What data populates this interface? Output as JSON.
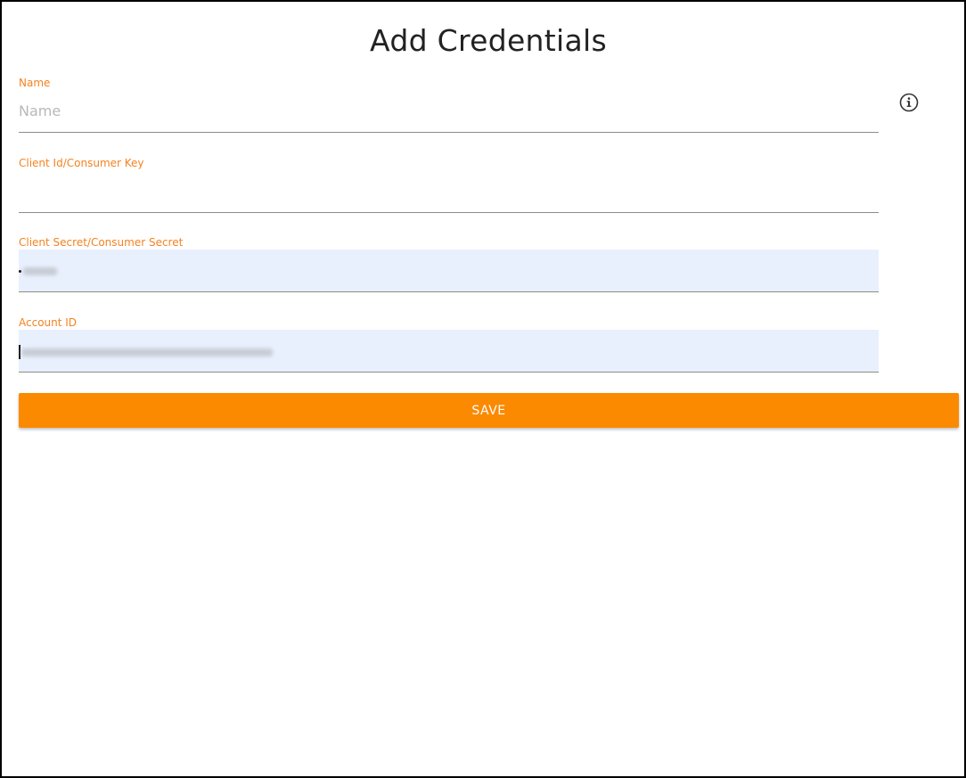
{
  "page": {
    "title": "Add Credentials"
  },
  "form": {
    "name": {
      "label": "Name",
      "placeholder": "Name",
      "value": ""
    },
    "client_id": {
      "label": "Client Id/Consumer Key",
      "value": ""
    },
    "client_secret": {
      "label": "Client Secret/Consumer Secret",
      "value_state": "masked-autofilled"
    },
    "account_id": {
      "label": "Account ID",
      "value_state": "obscured-autofilled"
    },
    "save_label": "SAVE"
  },
  "icons": {
    "info": "info-circle-icon"
  },
  "colors": {
    "accent": "#fb8a00",
    "label": "#f5821f",
    "autofill_bg": "#e8f0fe",
    "title": "#222222"
  }
}
